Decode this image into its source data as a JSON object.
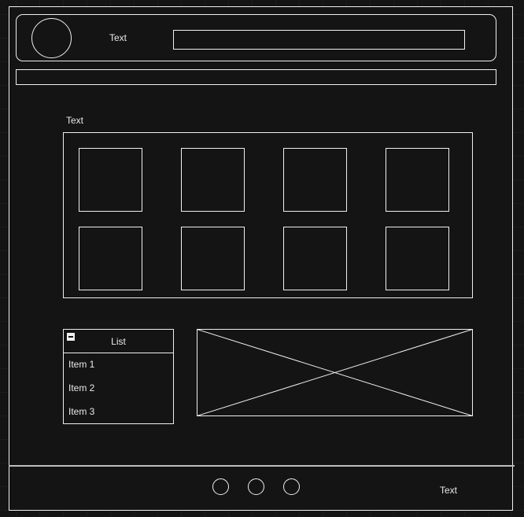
{
  "header": {
    "title": "Text"
  },
  "section": {
    "title": "Text"
  },
  "list": {
    "title": "List",
    "items": [
      "Item 1",
      "Item 2",
      "Item 3"
    ]
  },
  "footer": {
    "text": "Text"
  }
}
